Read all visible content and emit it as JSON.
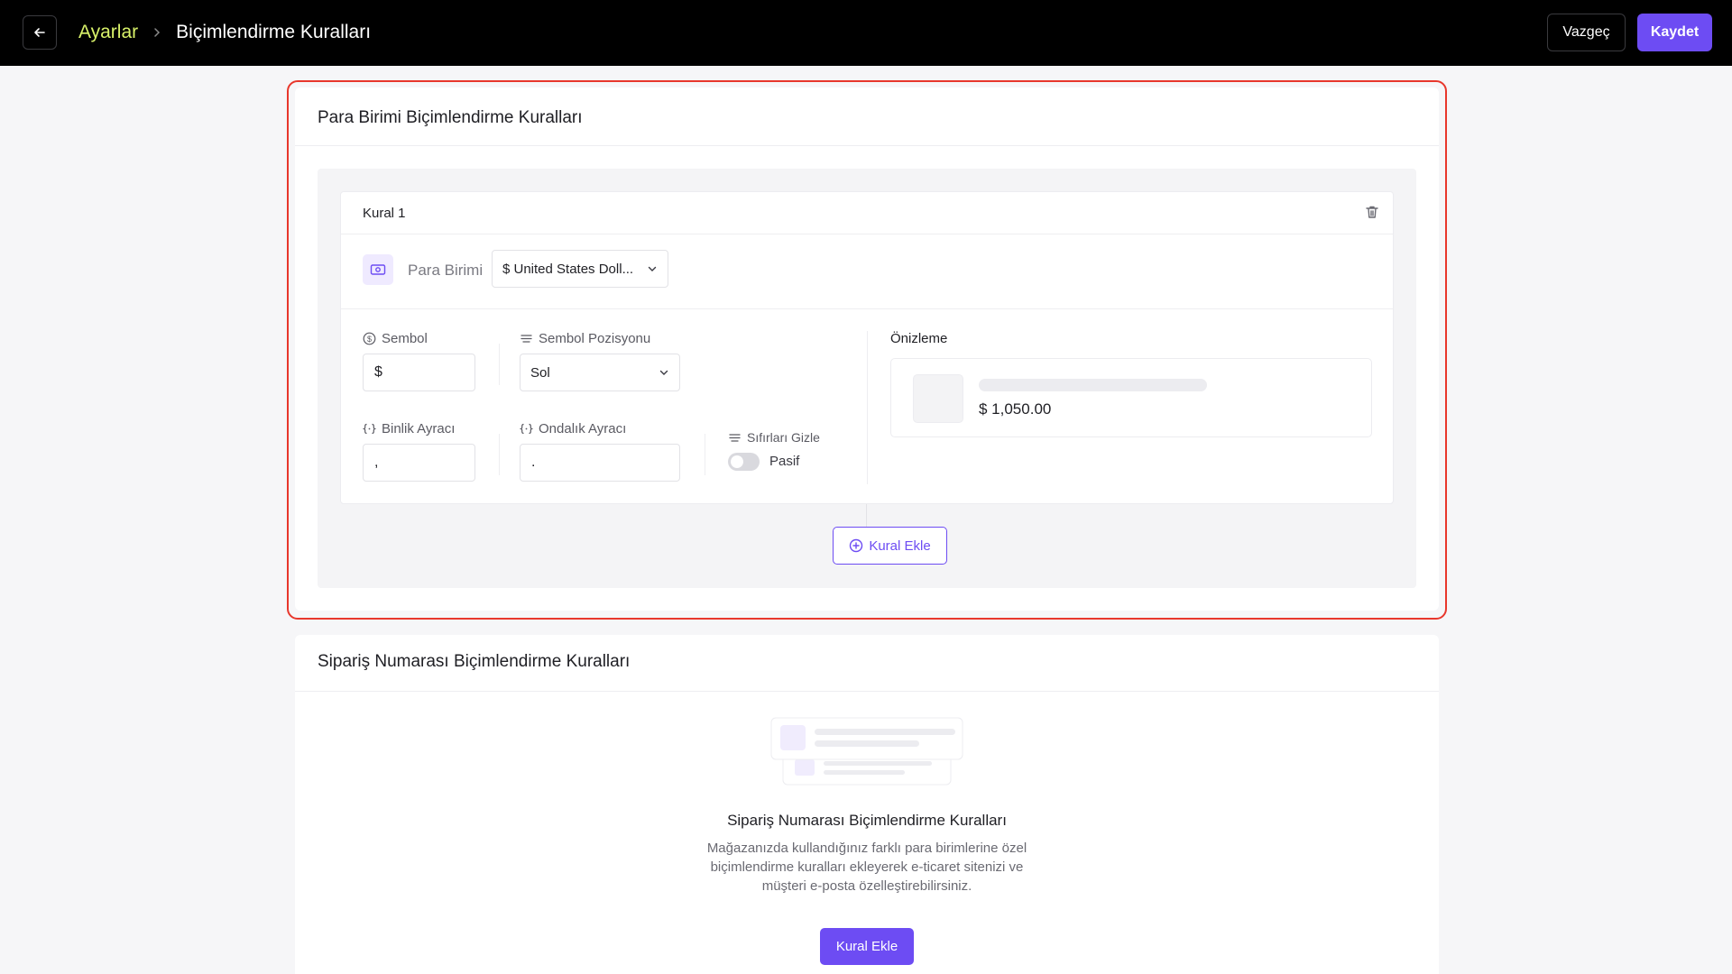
{
  "header": {
    "breadcrumb_parent": "Ayarlar",
    "breadcrumb_current": "Biçimlendirme Kuralları",
    "cancel_label": "Vazgeç",
    "save_label": "Kaydet"
  },
  "currency_section": {
    "title": "Para Birimi Biçimlendirme Kuralları",
    "rule": {
      "title": "Kural 1",
      "currency_label": "Para Birimi",
      "currency_value": "$ United States Doll...",
      "symbol_label": "Sembol",
      "symbol_value": "$",
      "symbol_position_label": "Sembol Pozisyonu",
      "symbol_position_value": "Sol",
      "thousands_label": "Binlik Ayracı",
      "thousands_value": ",",
      "decimal_label": "Ondalık Ayracı",
      "decimal_value": ".",
      "hide_zeros_label": "Sıfırları Gizle",
      "hide_zeros_state": "Pasif",
      "preview_title": "Önizleme",
      "preview_price": "$ 1,050.00"
    },
    "add_rule_label": "Kural Ekle"
  },
  "order_section": {
    "title": "Sipariş Numarası Biçimlendirme Kuralları",
    "empty_title": "Sipariş Numarası Biçimlendirme Kuralları",
    "empty_description": "Mağazanızda kullandığınız farklı para birimlerine özel biçimlendirme kuralları ekleyerek e-ticaret sitenizi ve müşteri e-posta özelleştirebilirsiniz.",
    "add_rule_label": "Kural Ekle"
  },
  "colors": {
    "accent": "#6d4cf3",
    "breadcrumb_parent": "#d9f26a",
    "highlight": "#e8372c"
  }
}
